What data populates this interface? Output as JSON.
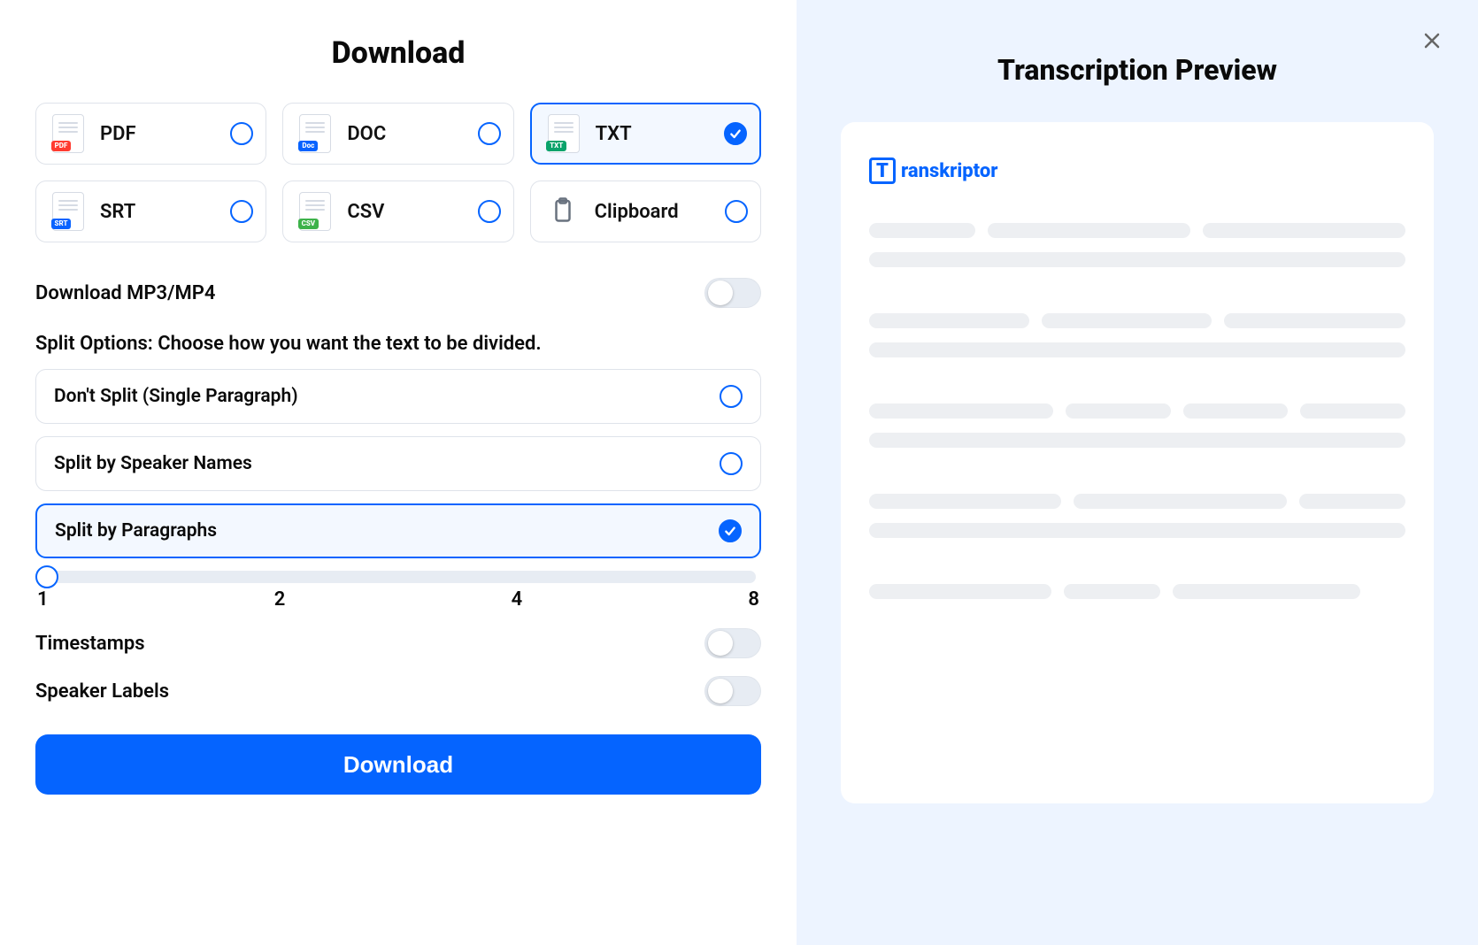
{
  "title": "Download",
  "formats": [
    {
      "key": "pdf",
      "label": "PDF",
      "tag": "PDF",
      "tagClass": "pdf",
      "selected": false
    },
    {
      "key": "doc",
      "label": "DOC",
      "tag": "Doc",
      "tagClass": "doc",
      "selected": false
    },
    {
      "key": "txt",
      "label": "TXT",
      "tag": "TXT",
      "tagClass": "txt",
      "selected": true
    },
    {
      "key": "srt",
      "label": "SRT",
      "tag": "SRT",
      "tagClass": "srt",
      "selected": false
    },
    {
      "key": "csv",
      "label": "CSV",
      "tag": "CSV",
      "tagClass": "csv",
      "selected": false
    },
    {
      "key": "clipboard",
      "label": "Clipboard",
      "tag": "",
      "tagClass": "",
      "selected": false
    }
  ],
  "download_media": {
    "label": "Download MP3/MP4",
    "on": false
  },
  "split_options_label": "Split Options: Choose how you want the text to be divided.",
  "split_options": [
    {
      "label": "Don't Split (Single Paragraph)",
      "selected": false
    },
    {
      "label": "Split by Speaker Names",
      "selected": false
    },
    {
      "label": "Split by Paragraphs",
      "selected": true
    }
  ],
  "slider": {
    "value": 1,
    "ticks": [
      "1",
      "2",
      "4",
      "8"
    ]
  },
  "timestamps": {
    "label": "Timestamps",
    "on": false
  },
  "speaker_labels": {
    "label": "Speaker Labels",
    "on": false
  },
  "download_button": "Download",
  "preview": {
    "title": "Transcription Preview",
    "brand": "ranskriptor",
    "brand_initial": "T"
  }
}
